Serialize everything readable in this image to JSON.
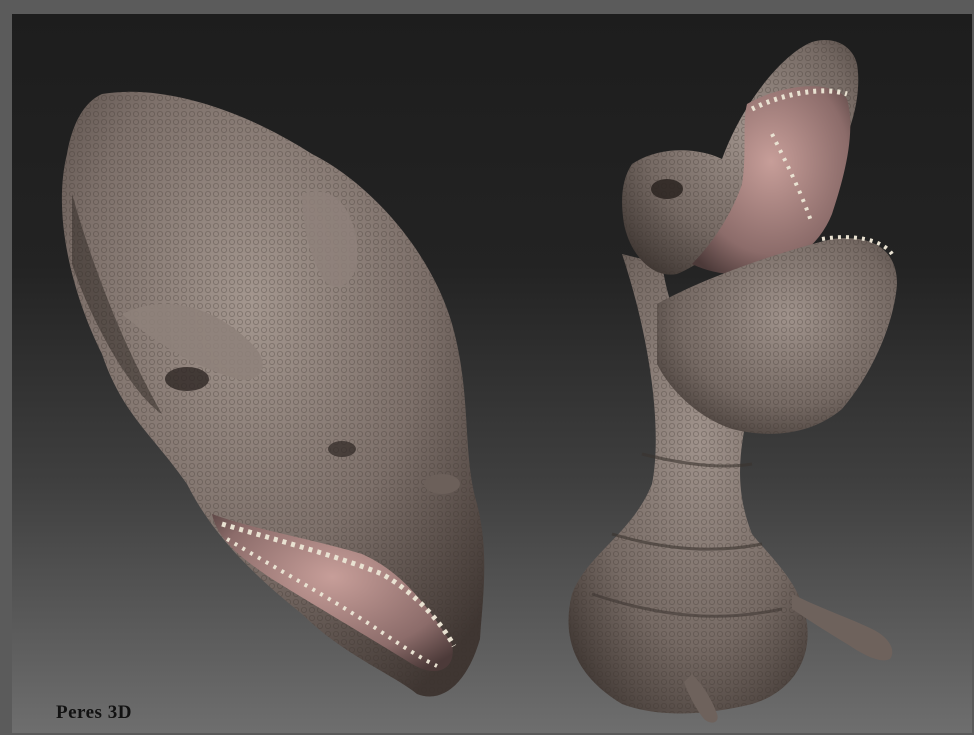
{
  "watermark": {
    "text": "Peres 3D"
  },
  "scene": {
    "subjects": [
      "trex-head-left",
      "trex-head-right"
    ],
    "colors": {
      "skin_base": "#7a6d66",
      "skin_light": "#a59890",
      "skin_dark": "#3f3632",
      "mouth_pink": "#b58e8a",
      "teeth": "#e9e2d2",
      "background_top": "#1d1d1d",
      "background_bottom": "#6e6e6e"
    }
  }
}
